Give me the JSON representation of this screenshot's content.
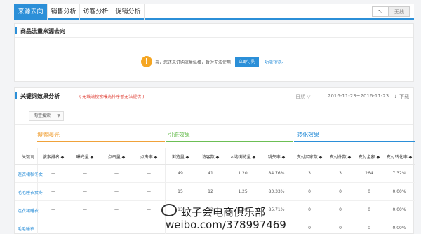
{
  "tabs": [
    {
      "label": "来源去向",
      "active": true
    },
    {
      "label": "销售分析",
      "active": false
    },
    {
      "label": "访客分析",
      "active": false
    },
    {
      "label": "促销分析",
      "active": false
    }
  ],
  "view_toggle": {
    "left": "⤡",
    "right": "无线"
  },
  "panel1": {
    "title": "商品流量来源去向",
    "notice": {
      "icon": "!",
      "message": "亲，您还未订购流量纵横，暂时无法使用！",
      "button": "立即订购",
      "link": "功能预览›"
    }
  },
  "panel2": {
    "title": "关键词效果分析",
    "warning": "( 无线端搜索曝光排序暂无法提供 )",
    "date_label": "日期 ▽",
    "date_range": "2016-11-23~2016-11-23",
    "download": "↓ 下载",
    "filter_select": "淘宝搜索",
    "groups": [
      "搜索曝光",
      "引流效果",
      "转化效果"
    ],
    "columns": [
      "关键词",
      "搜索排名 ◆",
      "曝光量 ◆",
      "点击量 ◆",
      "点击率 ◆",
      "浏览量 ◆",
      "访客数 ◆",
      "人均浏览量 ◆",
      "跳失率 ◆",
      "支付买家数 ◆",
      "支付件数 ◆",
      "支付金额 ◆",
      "支付转化率 ◆"
    ],
    "rows": [
      [
        "连衣裙秋冬女",
        "—",
        "—",
        "—",
        "—",
        "49",
        "41",
        "1.20",
        "84.76%",
        "3",
        "3",
        "264",
        "7.32%"
      ],
      [
        "毛毛睡衣女冬",
        "—",
        "—",
        "—",
        "—",
        "15",
        "12",
        "1.25",
        "83.33%",
        "0",
        "0",
        "0",
        "0.00%"
      ],
      [
        "连衣裙睡衣",
        "—",
        "—",
        "—",
        "—",
        "13",
        "12",
        "1.08",
        "85.71%",
        "0",
        "0",
        "0",
        "0.00%"
      ],
      [
        "毛毛睡衣",
        "—",
        "—",
        "—",
        "—",
        "",
        "",
        "",
        "",
        "0",
        "0",
        "0",
        "0.00%"
      ]
    ]
  },
  "watermark": {
    "line1": "蚊子会电商俱乐部",
    "line2": "weibo.com/378997469"
  }
}
